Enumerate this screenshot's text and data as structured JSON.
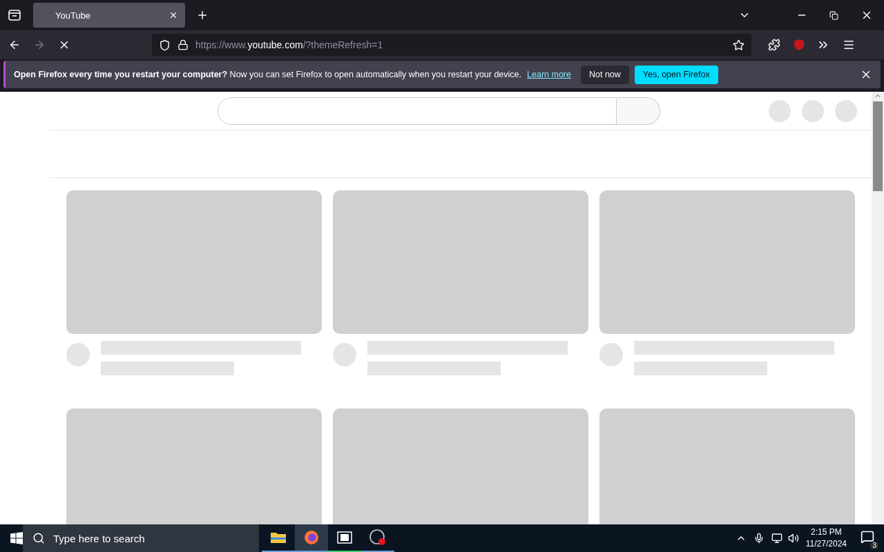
{
  "browser": {
    "tabs": [
      {
        "title": "YouTube",
        "selected": true
      }
    ],
    "url": {
      "scheme": "https://www.",
      "host": "youtube.com",
      "path": "/?themeRefresh=1"
    }
  },
  "notification": {
    "message": "**Open Firefox every time you restart your computer?** Now you can set Firefox to open automatically when you restart your device.",
    "link": "Learn more",
    "buttons": [
      {
        "label": "Not now",
        "kind": "secondary"
      },
      {
        "label": "Yes, open Firefox",
        "kind": "primary"
      }
    ]
  },
  "taskbar": {
    "search": {
      "placeholder": "Type here to search"
    },
    "time": "2:15 PM",
    "date": "11/27/2024",
    "notifications": "3"
  }
}
